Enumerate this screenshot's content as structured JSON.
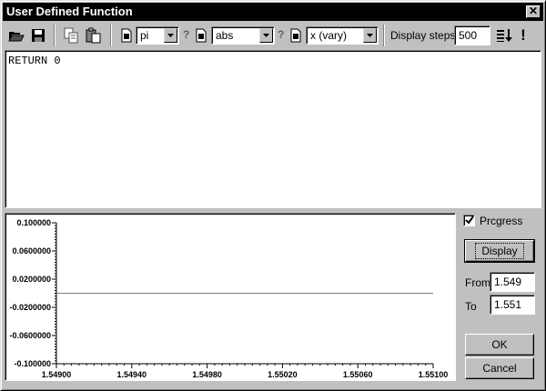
{
  "window": {
    "title": "User Defined Function",
    "close_glyph": "✕"
  },
  "toolbar": {
    "constant_select": {
      "value": "pi"
    },
    "function_select": {
      "value": "abs"
    },
    "variable_select": {
      "value": "x  (vary)"
    },
    "help_glyph": "?",
    "display_steps_label": "Display steps",
    "display_steps_value": "500",
    "run_glyph": "!"
  },
  "editor": {
    "code": "RETURN 0"
  },
  "plot": {
    "chart_data": {
      "type": "line",
      "x": [
        1.549,
        1.551
      ],
      "y": [
        0.0,
        0.0
      ],
      "xlim": [
        1.549,
        1.551
      ],
      "ylim": [
        -0.1,
        0.1
      ],
      "x_ticks": [
        "1.54900",
        "1.54940",
        "1.54980",
        "1.55020",
        "1.55060",
        "1.55100"
      ],
      "x_tick_values": [
        1.549,
        1.5494,
        1.5498,
        1.5502,
        1.5506,
        1.551
      ],
      "y_ticks": [
        "0.100000",
        "0.0600000",
        "0.0200000",
        "-0.0200000",
        "-0.0600000",
        "-0.100000"
      ],
      "y_tick_values": [
        0.1,
        0.06,
        0.02,
        -0.02,
        -0.06,
        -0.1
      ],
      "grid": false,
      "line_color": "#808080"
    }
  },
  "side": {
    "progress_label": "Prcgress",
    "progress_checked": true,
    "display_button": "Display",
    "from_label": "From",
    "from_value": "1.549",
    "to_label": "To",
    "to_value": "1.551",
    "ok_button": "OK",
    "cancel_button": "Cancel"
  }
}
